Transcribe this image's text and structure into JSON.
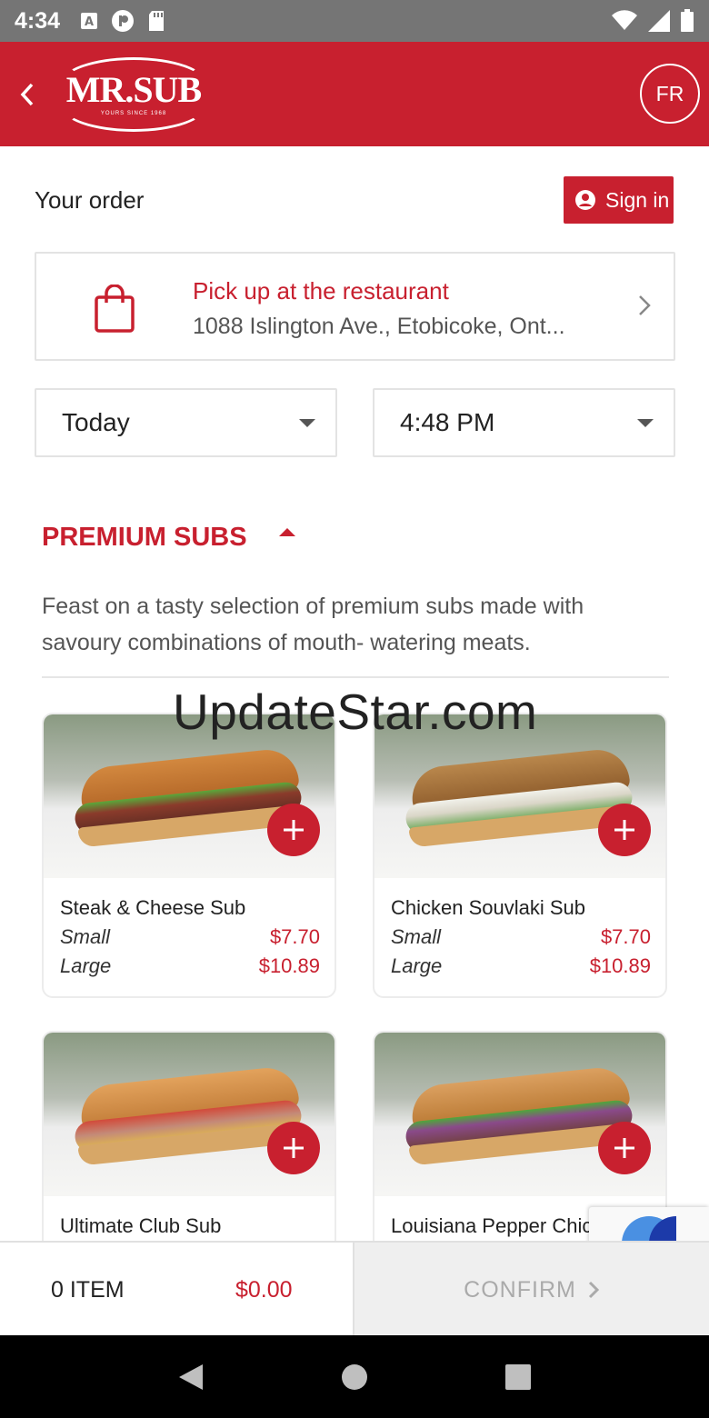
{
  "status_bar": {
    "time": "4:34"
  },
  "header": {
    "logo_text": "MR.SUB",
    "logo_tagline": "YOURS SINCE 1968",
    "language_button": "FR"
  },
  "order": {
    "title": "Your order",
    "signin_label": "Sign in",
    "pickup_title": "Pick up at the restaurant",
    "pickup_address": "1088 Islington Ave., Etobicoke, Ont...",
    "date_value": "Today",
    "time_value": "4:48 PM"
  },
  "category": {
    "title": "PREMIUM SUBS",
    "description": "Feast on a tasty selection of premium subs made with savoury combinations of mouth- watering meats."
  },
  "watermark": "UpdateStar.com",
  "products": [
    {
      "name": "Steak & Cheese Sub",
      "small_label": "Small",
      "small_price": "$7.70",
      "large_label": "Large",
      "large_price": "$10.89"
    },
    {
      "name": "Chicken Souvlaki Sub",
      "small_label": "Small",
      "small_price": "$7.70",
      "large_label": "Large",
      "large_price": "$10.89"
    },
    {
      "name": "Ultimate Club Sub"
    },
    {
      "name": "Louisiana Pepper Chic"
    }
  ],
  "cart": {
    "item_count": "0 ITEM",
    "total": "$0.00",
    "confirm_label": "CONFIRM"
  },
  "colors": {
    "brand_red": "#c8202f",
    "status_gray": "#757575"
  }
}
